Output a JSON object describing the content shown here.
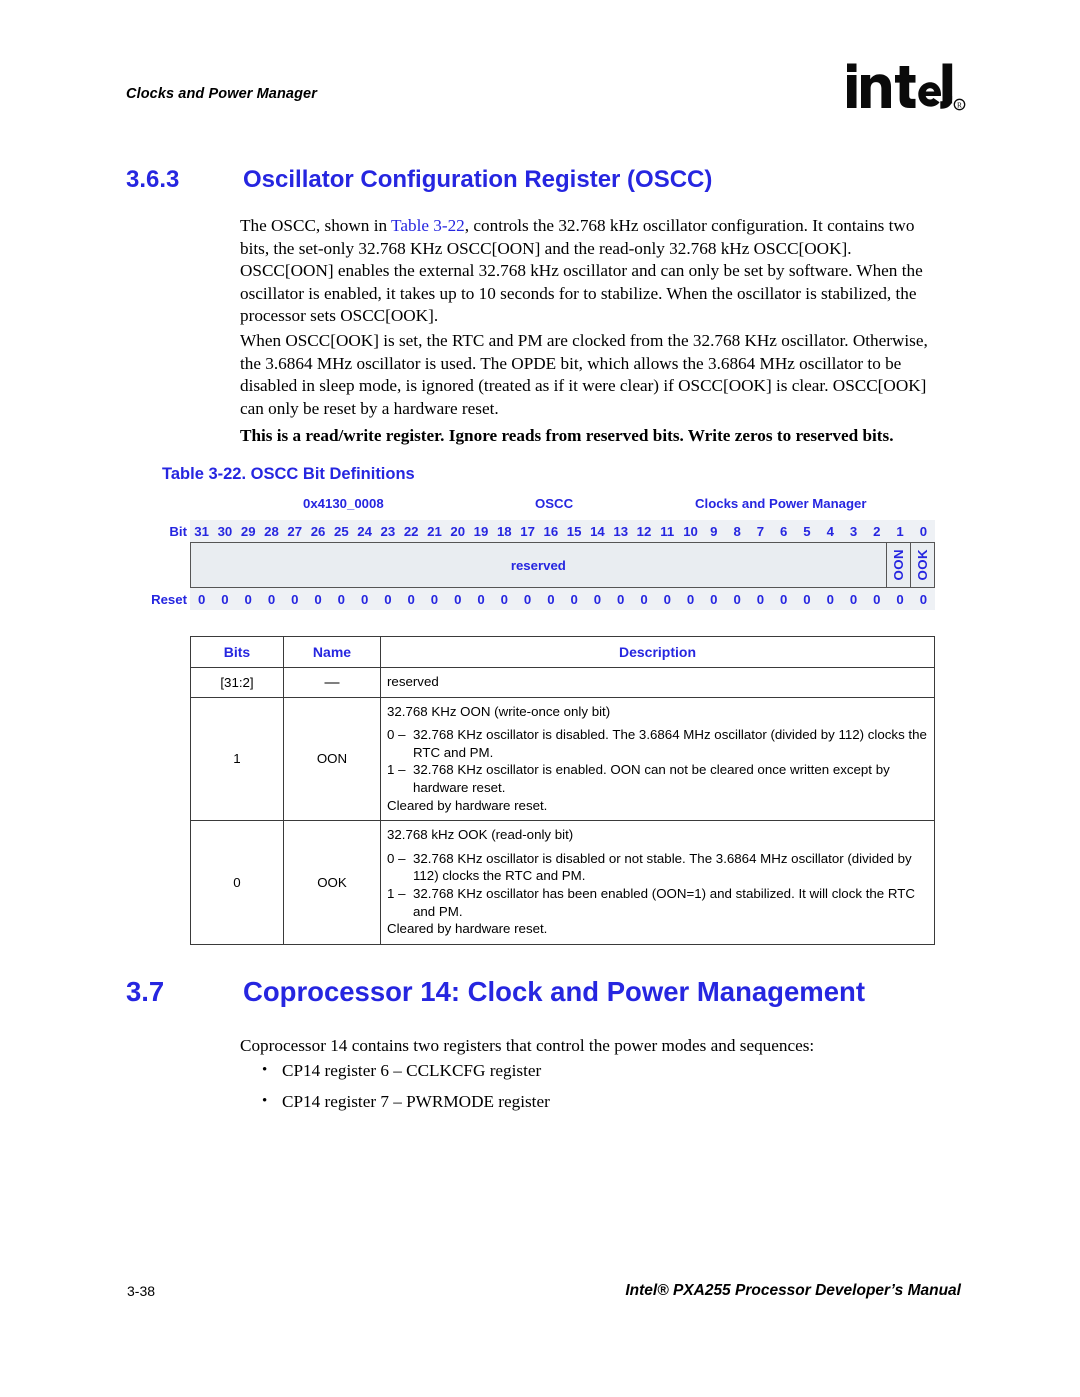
{
  "header": {
    "running_head": "Clocks and Power Manager",
    "logo_alt": "intel",
    "logo_registered": "®"
  },
  "section_363": {
    "number": "3.6.3",
    "title": "Oscillator Configuration Register (OSCC)",
    "para1_before_xref": "The OSCC, shown in ",
    "para1_xref": "Table 3-22",
    "para1_after_xref": ", controls the 32.768 kHz oscillator configuration. It contains two bits, the set-only 32.768 KHz OSCC[OON] and the read-only 32.768 kHz OSCC[OOK]. OSCC[OON] enables the external 32.768 kHz oscillator and can only be set by software. When the oscillator is enabled, it takes up to 10 seconds for to stabilize. When the oscillator is stabilized, the processor sets OSCC[OOK].",
    "para2": "When OSCC[OOK] is set, the RTC and PM are clocked from the 32.768 KHz oscillator. Otherwise, the 3.6864 MHz oscillator is used. The OPDE bit, which allows the 3.6864 MHz oscillator to be disabled in sleep mode, is ignored (treated as if it were clear) if OSCC[OOK] is clear. OSCC[OOK] can only be reset by a hardware reset.",
    "note": "This is a read/write register. Ignore reads from reserved bits. Write zeros to reserved bits."
  },
  "table_3_22": {
    "caption": "Table 3-22. OSCC Bit Definitions",
    "register": {
      "address": "0x4130_0008",
      "name": "OSCC",
      "unit": "Clocks and Power Manager",
      "bit_row_label": "Bit",
      "reset_row_label": "Reset",
      "bit_numbers": [
        31,
        30,
        29,
        28,
        27,
        26,
        25,
        24,
        23,
        22,
        21,
        20,
        19,
        18,
        17,
        16,
        15,
        14,
        13,
        12,
        11,
        10,
        9,
        8,
        7,
        6,
        5,
        4,
        3,
        2,
        1,
        0
      ],
      "reset_values": [
        "0",
        "0",
        "0",
        "0",
        "0",
        "0",
        "0",
        "0",
        "0",
        "0",
        "0",
        "0",
        "0",
        "0",
        "0",
        "0",
        "0",
        "0",
        "0",
        "0",
        "0",
        "0",
        "0",
        "0",
        "0",
        "0",
        "0",
        "0",
        "0",
        "0",
        "0",
        "0"
      ],
      "fields": [
        {
          "label": "reserved",
          "span": 30,
          "orientation": "horizontal"
        },
        {
          "label": "OON",
          "span": 1,
          "orientation": "vertical"
        },
        {
          "label": "OOK",
          "span": 1,
          "orientation": "vertical"
        }
      ]
    },
    "columns": [
      "Bits",
      "Name",
      "Description"
    ],
    "rows": [
      {
        "bits": "[31:2]",
        "name": "—",
        "lines": [
          {
            "kind": "plain",
            "text": "reserved"
          }
        ]
      },
      {
        "bits": "1",
        "name": "OON",
        "lines": [
          {
            "kind": "plain",
            "text": "32.768 KHz OON (write-once only bit)"
          },
          {
            "kind": "enum",
            "key": "0 –",
            "text": "32.768 KHz oscillator is disabled. The 3.6864 MHz oscillator (divided by 112) clocks the RTC and PM."
          },
          {
            "kind": "enum",
            "key": "1 –",
            "text": "32.768 KHz oscillator is enabled. OON can not be cleared once written except by hardware reset."
          },
          {
            "kind": "plain",
            "text": "Cleared by hardware reset."
          }
        ]
      },
      {
        "bits": "0",
        "name": "OOK",
        "lines": [
          {
            "kind": "plain",
            "text": "32.768 kHz OOK (read-only bit)"
          },
          {
            "kind": "enum",
            "key": "0 –",
            "text": "32.768 KHz oscillator is disabled or not stable. The 3.6864 MHz oscillator (divided by 112) clocks the RTC and PM."
          },
          {
            "kind": "enum",
            "key": "1 –",
            "text": "32.768 KHz oscillator has been enabled (OON=1) and stabilized. It will clock the RTC and PM."
          },
          {
            "kind": "plain",
            "text": "Cleared by hardware reset."
          }
        ]
      }
    ]
  },
  "section_37": {
    "number": "3.7",
    "title": "Coprocessor 14: Clock and Power Management",
    "intro": "Coprocessor 14 contains two registers that control the power modes and sequences:",
    "bullets": [
      "CP14 register 6 – CCLKCFG register",
      "CP14 register 7 – PWRMODE register"
    ]
  },
  "footer": {
    "page_number": "3-38",
    "manual_title": "Intel® PXA255 Processor Developer’s Manual"
  },
  "colors": {
    "heading_blue": "#2626e0",
    "table_band": "#eef1f5",
    "field_fill": "#e9edf1",
    "border": "#3a3a3a"
  }
}
